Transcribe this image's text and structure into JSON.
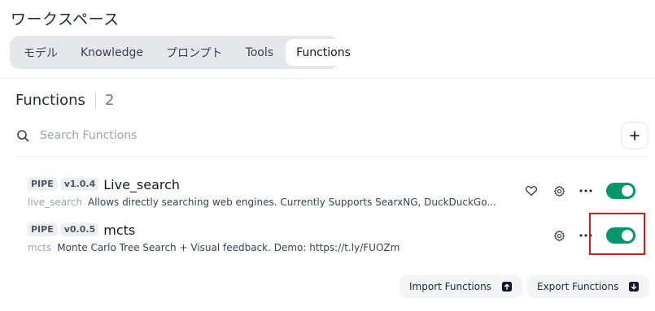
{
  "page": {
    "title": "ワークスペース"
  },
  "tabs": [
    {
      "label": "モデル",
      "active": false
    },
    {
      "label": "Knowledge",
      "active": false
    },
    {
      "label": "プロンプト",
      "active": false
    },
    {
      "label": "Tools",
      "active": false
    },
    {
      "label": "Functions",
      "active": true
    }
  ],
  "section": {
    "title": "Functions",
    "count": "2"
  },
  "search": {
    "placeholder": "Search Functions",
    "value": ""
  },
  "functions": [
    {
      "type_badge": "PIPE",
      "version_badge": "v1.0.4",
      "name": "Live_search",
      "id": "live_search",
      "description": "Allows directly searching web engines. Currently Supports SearxNG, DuckDuckGo...",
      "enabled": true,
      "has_favorite": true
    },
    {
      "type_badge": "PIPE",
      "version_badge": "v0.0.5",
      "name": "mcts",
      "id": "mcts",
      "description": "Monte Carlo Tree Search + Visual feedback. Demo: https://t.ly/FUOZm",
      "enabled": true,
      "has_favorite": false
    }
  ],
  "actions": {
    "import_label": "Import Functions",
    "export_label": "Export Functions"
  },
  "colors": {
    "toggle_on": "#059669",
    "highlight": "#e5161c"
  }
}
